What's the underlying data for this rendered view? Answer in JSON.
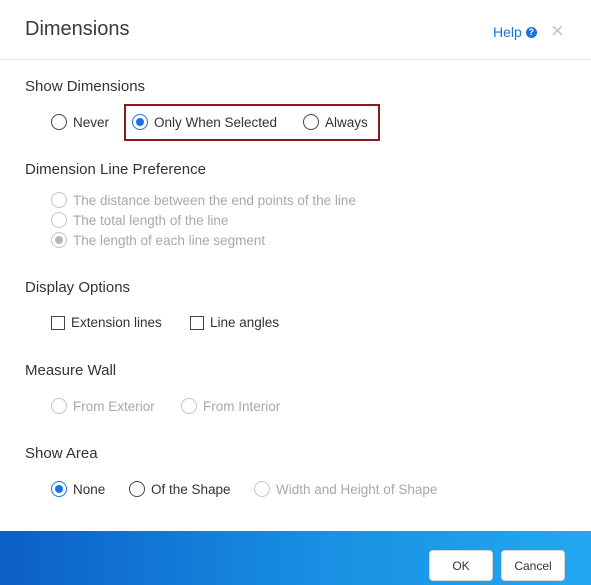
{
  "dialog": {
    "title": "Dimensions",
    "help_label": "Help",
    "help_icon": "?",
    "close_icon": "×"
  },
  "sections": {
    "show_dimensions": {
      "title": "Show Dimensions",
      "options": [
        "Never",
        "Only When Selected",
        "Always"
      ],
      "selected": "Only When Selected"
    },
    "dimension_line_preference": {
      "title": "Dimension Line Preference",
      "options": [
        "The distance between the end points of the line",
        "The total length of the line",
        "The length of each line segment"
      ],
      "selected": "The length of each line segment",
      "disabled": true
    },
    "display_options": {
      "title": "Display Options",
      "checkboxes": [
        {
          "label": "Extension lines",
          "checked": false
        },
        {
          "label": "Line angles",
          "checked": false
        }
      ]
    },
    "measure_wall": {
      "title": "Measure Wall",
      "options": [
        "From Exterior",
        "From Interior"
      ],
      "disabled": true
    },
    "show_area": {
      "title": "Show Area",
      "options": [
        "None",
        "Of the Shape",
        "Width and Height of Shape"
      ],
      "selected": "None",
      "disabled_options": [
        "Width and Height of Shape"
      ]
    }
  },
  "footer": {
    "ok_label": "OK",
    "cancel_label": "Cancel"
  },
  "colors": {
    "accent": "#1a73e8",
    "highlight_border": "#8b1a1a",
    "footer_gradient_start": "#0b5fc7",
    "footer_gradient_end": "#22a8f0"
  }
}
